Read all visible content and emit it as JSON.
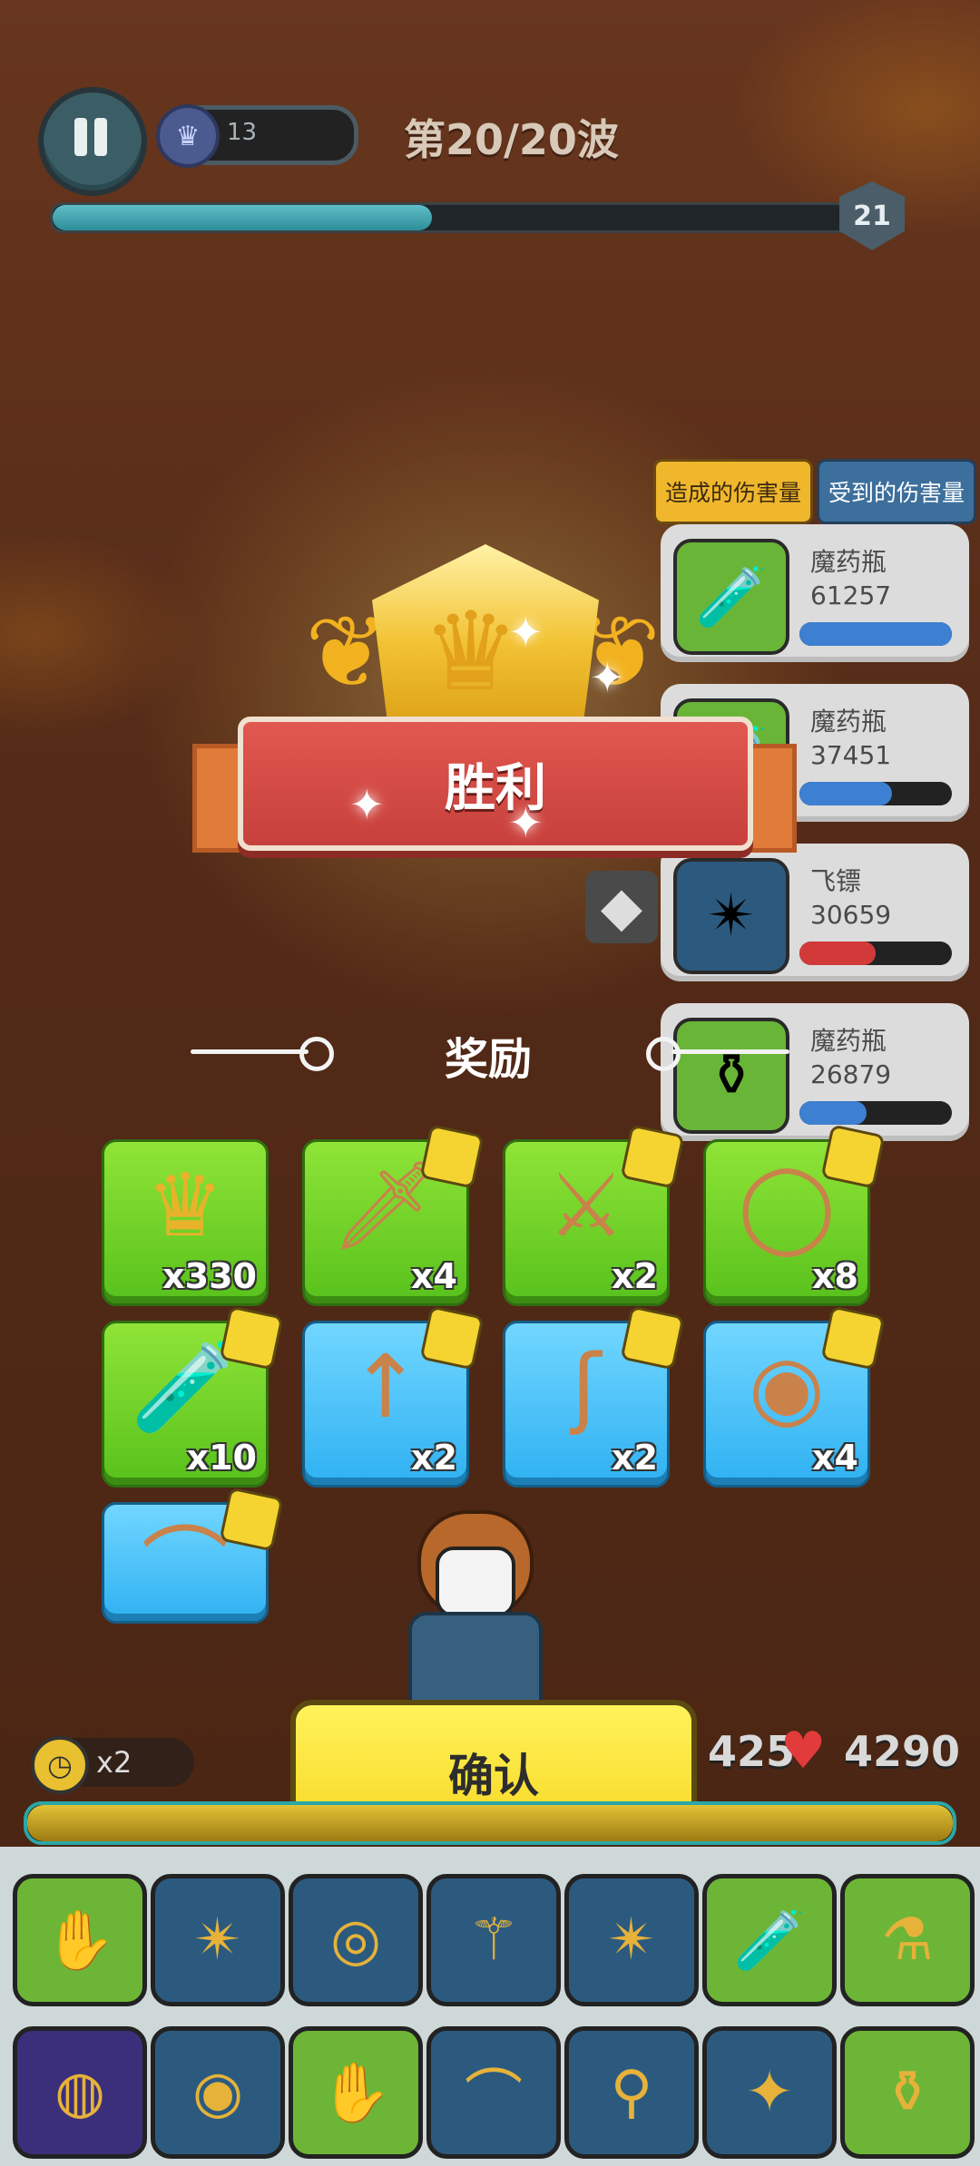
{
  "hud": {
    "crown_count": "13",
    "wave_text": "第20/20波",
    "wave_progress": 0.47,
    "level": "21"
  },
  "damage_panel": {
    "tab_dealt": "造成的伤害量",
    "tab_received": "受到的伤害量",
    "rows": [
      {
        "name": "魔药瓶",
        "value": "61257",
        "bar_fraction": 1.0,
        "bar_color": "#3d7fd0",
        "icon": "red-potion-icon"
      },
      {
        "name": "魔药瓶",
        "value": "37451",
        "bar_fraction": 0.61,
        "bar_color": "#3d7fd0",
        "icon": "potion-icon"
      },
      {
        "name": "飞镖",
        "value": "30659",
        "bar_fraction": 0.5,
        "bar_color": "#d23a3a",
        "icon": "shuriken-icon"
      },
      {
        "name": "魔药瓶",
        "value": "26879",
        "bar_fraction": 0.44,
        "bar_color": "#3d7fd0",
        "icon": "blue-potion-icon"
      }
    ]
  },
  "victory": {
    "title": "胜利"
  },
  "rewards": {
    "title": "奖励",
    "items": [
      {
        "icon": "crown-coin-icon",
        "qty": "x330",
        "tint": "green"
      },
      {
        "icon": "dagger-icon",
        "qty": "x4",
        "tint": "green"
      },
      {
        "icon": "sword-icon",
        "qty": "x2",
        "tint": "green"
      },
      {
        "icon": "ring-icon",
        "qty": "x8",
        "tint": "green"
      },
      {
        "icon": "green-vial-icon",
        "qty": "x10",
        "tint": "green"
      },
      {
        "icon": "spear-icon",
        "qty": "x2",
        "tint": "blue"
      },
      {
        "icon": "hook-icon",
        "qty": "x2",
        "tint": "blue"
      },
      {
        "icon": "round-shield-icon",
        "qty": "x4",
        "tint": "blue"
      },
      {
        "icon": "crossbow-icon",
        "qty": "",
        "tint": "blue"
      }
    ]
  },
  "bottom": {
    "speed": "x2",
    "confirm_label": "确认",
    "hp_left": "425",
    "hp_right": "4290",
    "hp_fraction": 1.0
  },
  "tray": [
    {
      "icon": "golden-gauntlet-icon",
      "tint": "green"
    },
    {
      "icon": "shuriken-icon",
      "tint": "navy"
    },
    {
      "icon": "red-shield-icon",
      "tint": "navy"
    },
    {
      "icon": "wand-icon",
      "tint": "navy"
    },
    {
      "icon": "shuriken-icon",
      "tint": "navy"
    },
    {
      "icon": "red-potion-icon",
      "tint": "green"
    },
    {
      "icon": "yellow-potion-icon",
      "tint": "green"
    },
    {
      "icon": "purple-ring-icon",
      "tint": "purple"
    },
    {
      "icon": "blue-shield-icon",
      "tint": "navy"
    },
    {
      "icon": "golden-gauntlet-icon",
      "tint": "green"
    },
    {
      "icon": "crossbow-icon",
      "tint": "navy"
    },
    {
      "icon": "staff-icon",
      "tint": "navy"
    },
    {
      "icon": "star-blade-icon",
      "tint": "navy"
    },
    {
      "icon": "blue-potion-icon",
      "tint": "green"
    }
  ]
}
